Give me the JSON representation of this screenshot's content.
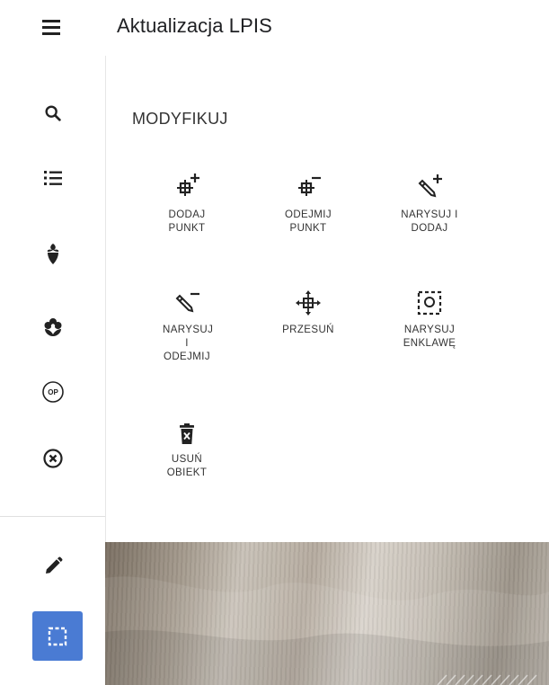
{
  "app": {
    "title": "Aktualizacja LPIS"
  },
  "rail": {
    "items": [
      {
        "icon": "search-icon"
      },
      {
        "icon": "list-icon"
      },
      {
        "icon": "crop-plant-icon"
      },
      {
        "icon": "flower-icon"
      },
      {
        "icon": "op-badge-icon",
        "text": "OP"
      },
      {
        "icon": "close-circle-icon"
      }
    ],
    "bottom": [
      {
        "icon": "pencil-icon"
      },
      {
        "icon": "selection-icon",
        "active": true
      }
    ]
  },
  "panel": {
    "title": "MODYFIKUJ",
    "tools": [
      {
        "icon": "add-point-icon",
        "label": "DODAJ PUNKT"
      },
      {
        "icon": "remove-point-icon",
        "label": "ODEJMIJ PUNKT"
      },
      {
        "icon": "draw-add-icon",
        "label": "NARYSUJ I DODAJ"
      },
      {
        "icon": "draw-subtract-icon",
        "label": "NARYSUJ I ODEJMIJ"
      },
      {
        "icon": "move-icon",
        "label": "PRZESUŃ"
      },
      {
        "icon": "draw-enclave-icon",
        "label": "NARYSUJ ENKLAWĘ"
      },
      {
        "icon": "delete-icon",
        "label": "USUŃ OBIEKT"
      }
    ]
  },
  "colors": {
    "accent": "#4a7bd3",
    "icon": "#222222",
    "text": "#333333"
  }
}
